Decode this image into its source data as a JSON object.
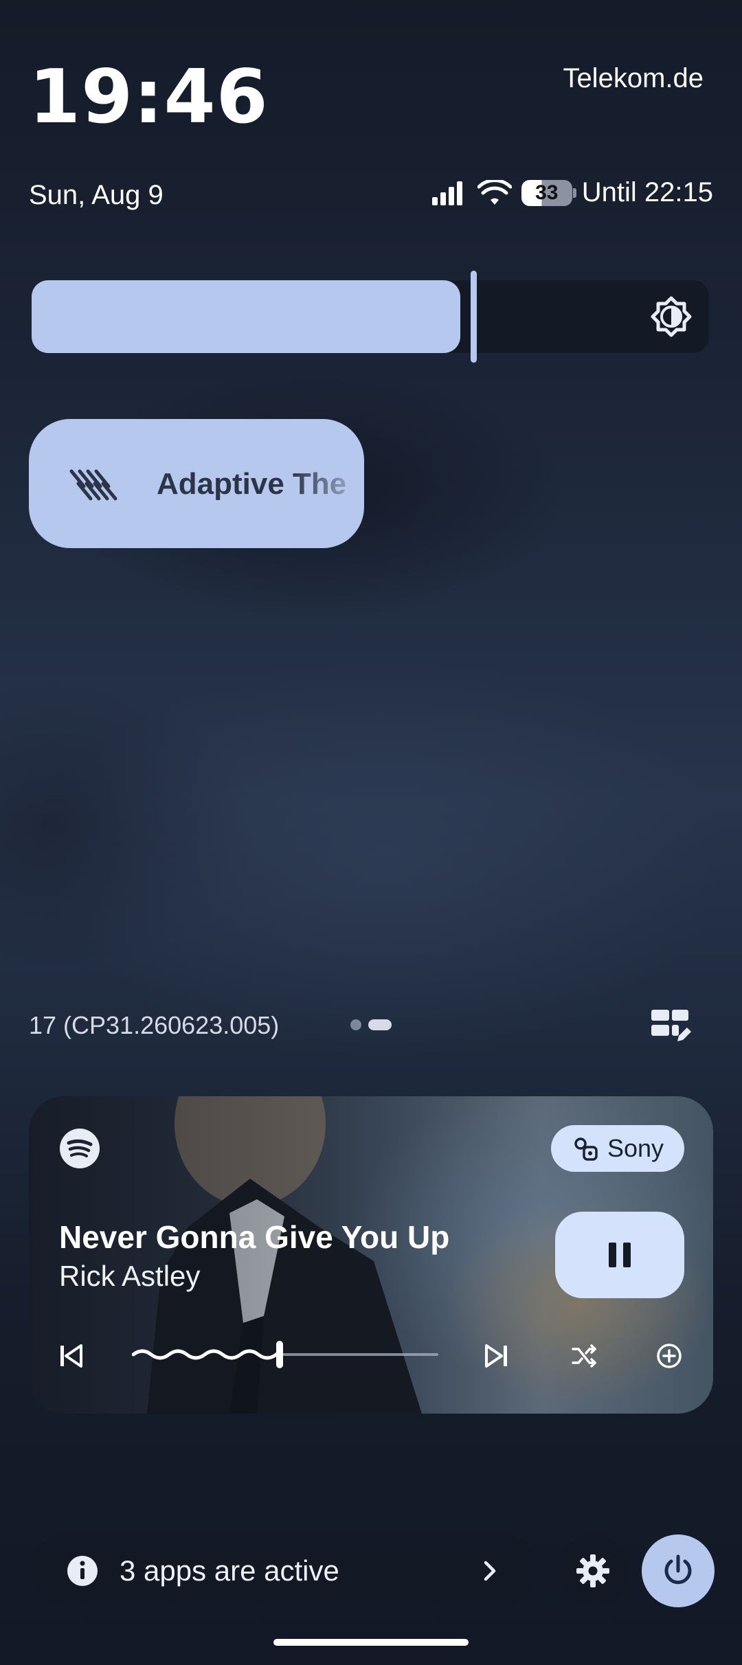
{
  "status_bar": {
    "time": "19:46",
    "carrier": "Telekom.de",
    "date": "Sun, Aug 9",
    "battery_level": "33",
    "battery_text": "Until 22:15",
    "signal_icon": "cellular-signal-icon",
    "wifi_icon": "wifi-icon"
  },
  "brightness": {
    "level_fraction": 0.63,
    "icon": "brightness-icon"
  },
  "tiles": [
    {
      "label": "Adaptive The",
      "icon": "adaptive-theme-icon",
      "active": true
    }
  ],
  "footer": {
    "build": "17 (CP31.260623.005)",
    "page_count": 2,
    "current_page": 2,
    "edit_icon": "edit-tiles-icon"
  },
  "media": {
    "app_icon": "spotify-icon",
    "output_device": "Sony",
    "output_icon": "speaker-group-icon",
    "title": "Never Gonna Give You Up",
    "artist": "Rick Astley",
    "state": "playing",
    "progress_fraction": 0.49,
    "controls": [
      "previous-icon",
      "next-icon",
      "shuffle-icon",
      "add-icon"
    ]
  },
  "bottom": {
    "apps_active": "3 apps are active",
    "info_icon": "info-icon",
    "settings_icon": "gear-icon",
    "power_icon": "power-icon"
  },
  "colors": {
    "accent": "#b7c8ee",
    "chip": "#d4e3fb",
    "dark_surface": "#121824"
  }
}
